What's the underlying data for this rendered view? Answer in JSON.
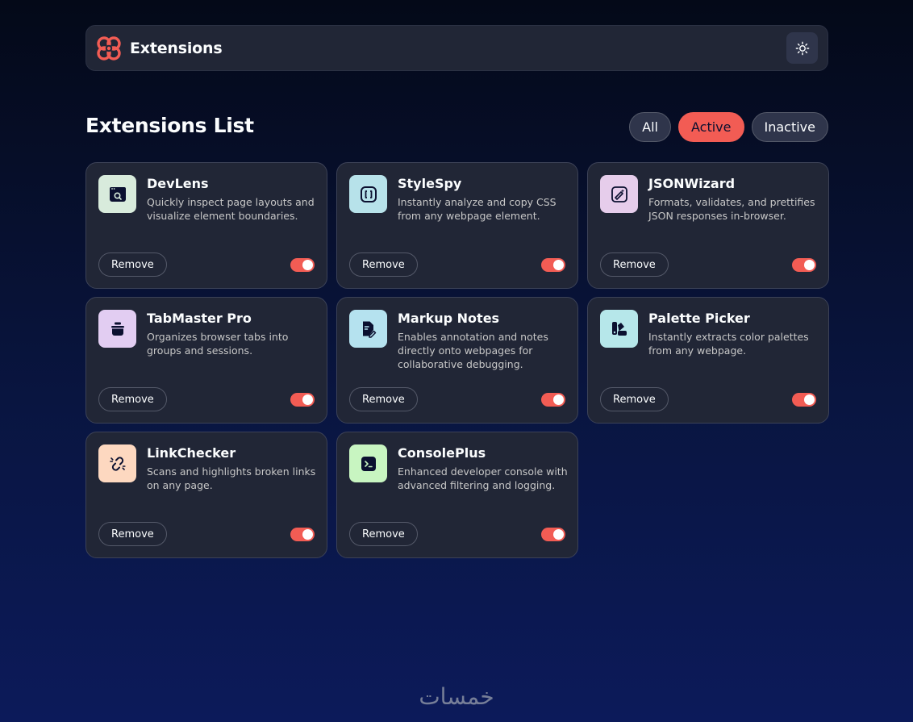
{
  "header": {
    "app_name": "Extensions",
    "logo_icon": "extensions-logo-icon",
    "theme_icon": "sun-icon",
    "brand_color": "#f25c54"
  },
  "main": {
    "title": "Extensions List",
    "filters": [
      {
        "label": "All",
        "active": false
      },
      {
        "label": "Active",
        "active": true
      },
      {
        "label": "Inactive",
        "active": false
      }
    ]
  },
  "extensions": [
    {
      "name": "DevLens",
      "description": "Quickly inspect page layouts and visualize element boundaries.",
      "icon": "search-window-icon",
      "icon_bg": "#d8ebdc",
      "remove_label": "Remove",
      "enabled": true
    },
    {
      "name": "StyleSpy",
      "description": "Instantly analyze and copy CSS from any webpage element.",
      "icon": "brackets-icon",
      "icon_bg": "#b7e2ea",
      "remove_label": "Remove",
      "enabled": true
    },
    {
      "name": "JSONWizard",
      "description": "Formats, validates, and prettifies JSON responses in-browser.",
      "icon": "wand-icon",
      "icon_bg": "#e6cdeb",
      "remove_label": "Remove",
      "enabled": true
    },
    {
      "name": "TabMaster Pro",
      "description": "Organizes browser tabs into groups and sessions.",
      "icon": "tab-stack-icon",
      "icon_bg": "#e2cdf2",
      "remove_label": "Remove",
      "enabled": true
    },
    {
      "name": "Markup Notes",
      "description": "Enables annotation and notes directly onto webpages for collaborative debugging.",
      "icon": "note-pen-icon",
      "icon_bg": "#b5e2ef",
      "remove_label": "Remove",
      "enabled": true
    },
    {
      "name": "Palette Picker",
      "description": "Instantly extracts color palettes from any webpage.",
      "icon": "palette-icon",
      "icon_bg": "#b6e7ea",
      "remove_label": "Remove",
      "enabled": true
    },
    {
      "name": "LinkChecker",
      "description": "Scans and highlights broken links on any page.",
      "icon": "broken-link-icon",
      "icon_bg": "#fdd8c0",
      "remove_label": "Remove",
      "enabled": true
    },
    {
      "name": "ConsolePlus",
      "description": "Enhanced developer console with advanced filtering and logging.",
      "icon": "terminal-icon",
      "icon_bg": "#c8f5c1",
      "remove_label": "Remove",
      "enabled": true
    }
  ],
  "footer": {
    "watermark": "خمسات"
  }
}
